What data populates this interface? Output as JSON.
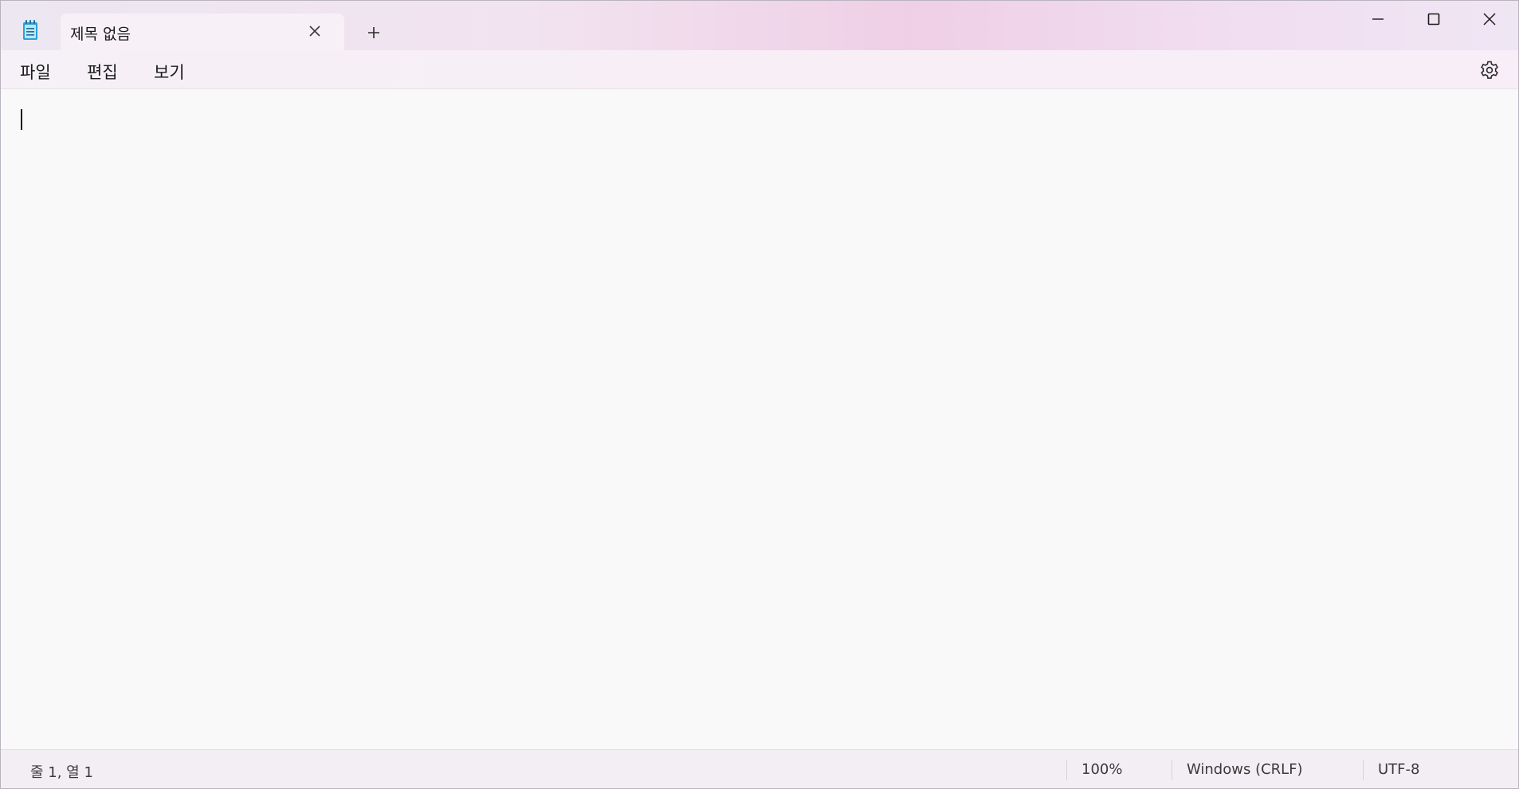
{
  "window": {
    "app_icon": "notepad-icon"
  },
  "tab": {
    "title": "제목 없음",
    "close_icon": "close-icon"
  },
  "new_tab_icon": "plus-icon",
  "window_controls": {
    "minimize_icon": "minimize-icon",
    "maximize_icon": "maximize-icon",
    "close_icon": "close-icon"
  },
  "menu": {
    "file": "파일",
    "edit": "편집",
    "view": "보기",
    "settings_icon": "gear-icon"
  },
  "editor": {
    "content": ""
  },
  "status": {
    "position": "줄 1, 열 1",
    "zoom": "100%",
    "line_ending": "Windows (CRLF)",
    "encoding": "UTF-8"
  },
  "colors": {
    "app_icon_accent": "#2aa1d8",
    "text": "#1b1b1b",
    "editor_bg": "#f9f9f9"
  }
}
